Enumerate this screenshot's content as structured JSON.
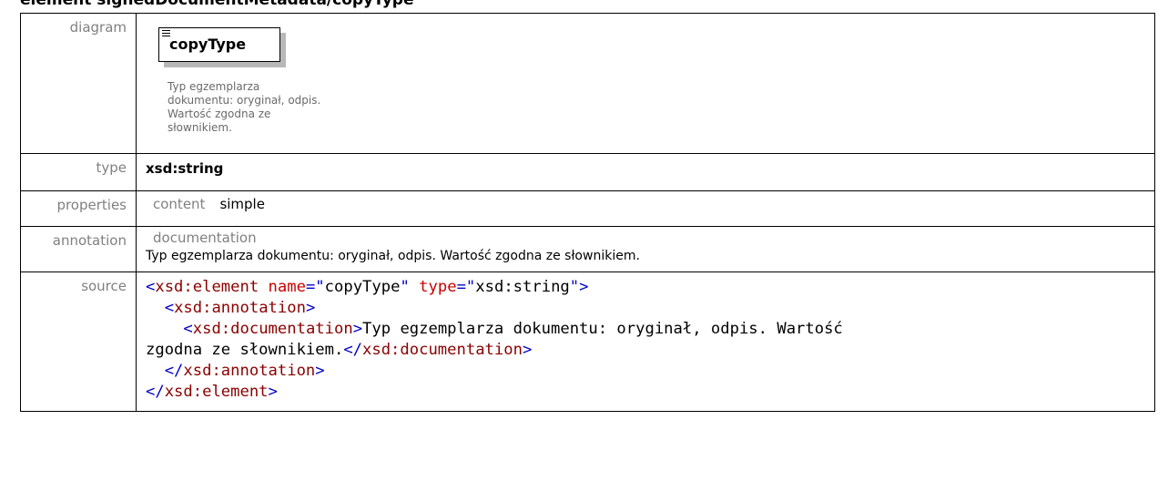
{
  "heading": "element signedDocumentMetadata/copyType",
  "rows": {
    "diagram": {
      "label": "diagram",
      "element_name": "copyType",
      "doc_lines": [
        "Typ egzemplarza",
        "dokumentu: oryginał, odpis.",
        "Wartość zgodna ze",
        "słownikiem."
      ]
    },
    "type": {
      "label": "type",
      "value": "xsd:string"
    },
    "properties": {
      "label": "properties",
      "key": "content",
      "value": "simple"
    },
    "annotation": {
      "label": "annotation",
      "key": "documentation",
      "value": "Typ egzemplarza dokumentu: oryginał, odpis. Wartość zgodna ze słownikiem."
    },
    "source": {
      "label": "source",
      "lines": [
        [
          [
            "t",
            "<"
          ],
          [
            "tn",
            "xsd:element"
          ],
          [
            "tx",
            " "
          ],
          [
            "an",
            "name"
          ],
          [
            "t",
            "=\""
          ],
          [
            "tx",
            "copyType"
          ],
          [
            "t",
            "\""
          ],
          [
            "tx",
            " "
          ],
          [
            "an",
            "type"
          ],
          [
            "t",
            "=\""
          ],
          [
            "tx",
            "xsd:string"
          ],
          [
            "t",
            "\">"
          ]
        ],
        [
          [
            "tx",
            "  "
          ],
          [
            "t",
            "<"
          ],
          [
            "tn",
            "xsd:annotation"
          ],
          [
            "t",
            ">"
          ]
        ],
        [
          [
            "tx",
            "    "
          ],
          [
            "t",
            "<"
          ],
          [
            "tn",
            "xsd:documentation"
          ],
          [
            "t",
            ">"
          ],
          [
            "tx",
            "Typ egzemplarza dokumentu: oryginał, odpis. Wartość"
          ]
        ],
        [
          [
            "tx",
            "zgodna ze słownikiem."
          ],
          [
            "t",
            "</"
          ],
          [
            "tn",
            "xsd:documentation"
          ],
          [
            "t",
            ">"
          ]
        ],
        [
          [
            "tx",
            "  "
          ],
          [
            "t",
            "</"
          ],
          [
            "tn",
            "xsd:annotation"
          ],
          [
            "t",
            ">"
          ]
        ],
        [
          [
            "t",
            "</"
          ],
          [
            "tn",
            "xsd:element"
          ],
          [
            "t",
            ">"
          ]
        ]
      ]
    }
  },
  "colors": {
    "tag_bracket": "#0000cc",
    "tag_name": "#8b0000",
    "attr_name": "#cc0000",
    "label_gray": "#808080"
  }
}
